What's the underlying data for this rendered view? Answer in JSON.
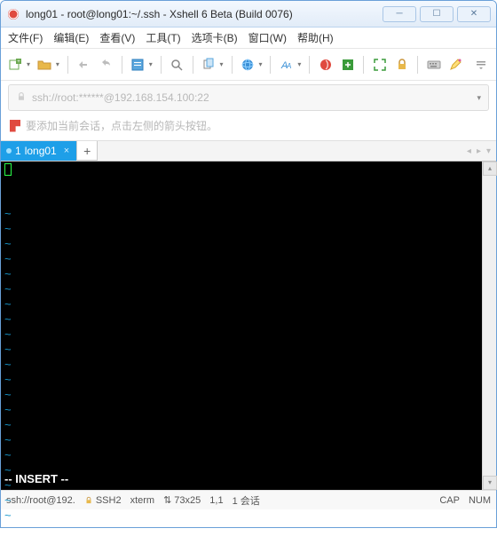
{
  "window": {
    "title": "long01 - root@long01:~/.ssh - Xshell 6 Beta (Build 0076)"
  },
  "menu": {
    "file": "文件(F)",
    "edit": "编辑(E)",
    "view": "查看(V)",
    "tools": "工具(T)",
    "tabs": "选项卡(B)",
    "window": "窗口(W)",
    "help": "帮助(H)"
  },
  "address": {
    "url": "ssh://root:******@192.168.154.100:22"
  },
  "hint": {
    "text": "要添加当前会话，点击左侧的箭头按钮。"
  },
  "tab": {
    "index": "1",
    "label": "long01"
  },
  "terminal": {
    "mode": "-- INSERT --"
  },
  "status": {
    "conn": "ssh://root@192.",
    "proto": "SSH2",
    "term": "xterm",
    "size": "73x25",
    "pos": "1,1",
    "sessions": "1 会话",
    "cap": "CAP",
    "num": "NUM"
  },
  "icons": {
    "sizeArrows": "⇅"
  }
}
